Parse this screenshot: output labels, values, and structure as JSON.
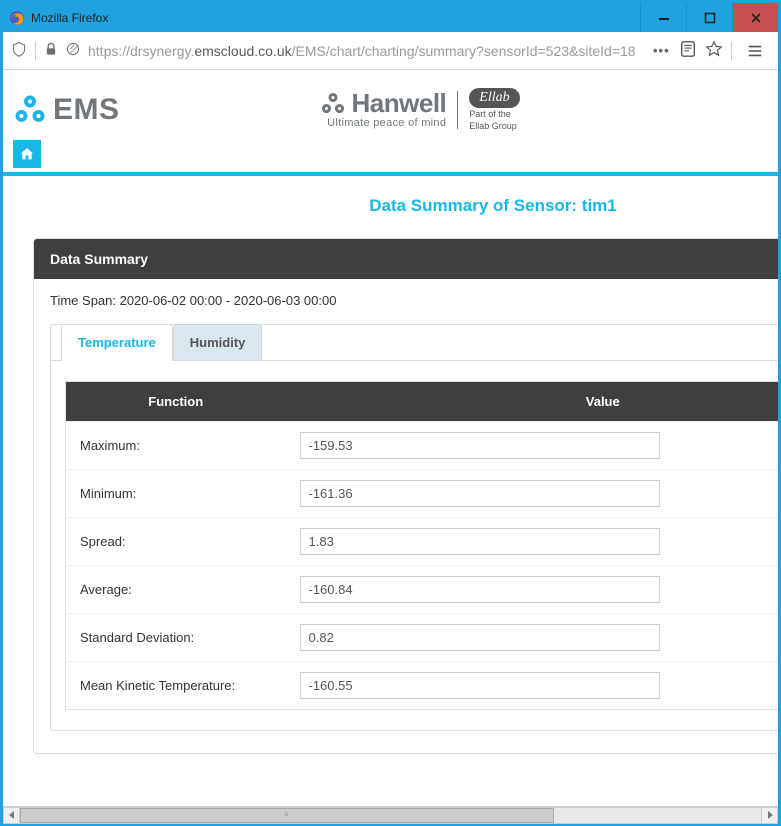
{
  "window": {
    "title": "Mozilla Firefox"
  },
  "urlbar": {
    "prefix": "https://drsynergy.",
    "domain": "emscloud.co.uk",
    "path": "/EMS/chart/charting/summary?sensorId=523&siteId=18"
  },
  "brand": {
    "ems": "EMS",
    "hanwell": "Hanwell",
    "hanwell_tag": "Ultimate peace of mind",
    "ellab_badge": "Ellab",
    "ellab_sub_line1": "Part of the",
    "ellab_sub_line2": "Ellab Group"
  },
  "page": {
    "title": "Data Summary of Sensor: tim1",
    "panel_header": "Data Summary",
    "timespan": "Time Span: 2020-06-02 00:00 - 2020-06-03 00:00"
  },
  "tabs": [
    {
      "label": "Temperature",
      "active": true
    },
    {
      "label": "Humidity",
      "active": false
    }
  ],
  "table": {
    "head_function": "Function",
    "head_value": "Value",
    "rows": [
      {
        "label": "Maximum:",
        "value": "-159.53"
      },
      {
        "label": "Minimum:",
        "value": "-161.36"
      },
      {
        "label": "Spread:",
        "value": "1.83"
      },
      {
        "label": "Average:",
        "value": "-160.84"
      },
      {
        "label": "Standard Deviation:",
        "value": "0.82"
      },
      {
        "label": "Mean Kinetic Temperature:",
        "value": "-160.55"
      }
    ]
  }
}
